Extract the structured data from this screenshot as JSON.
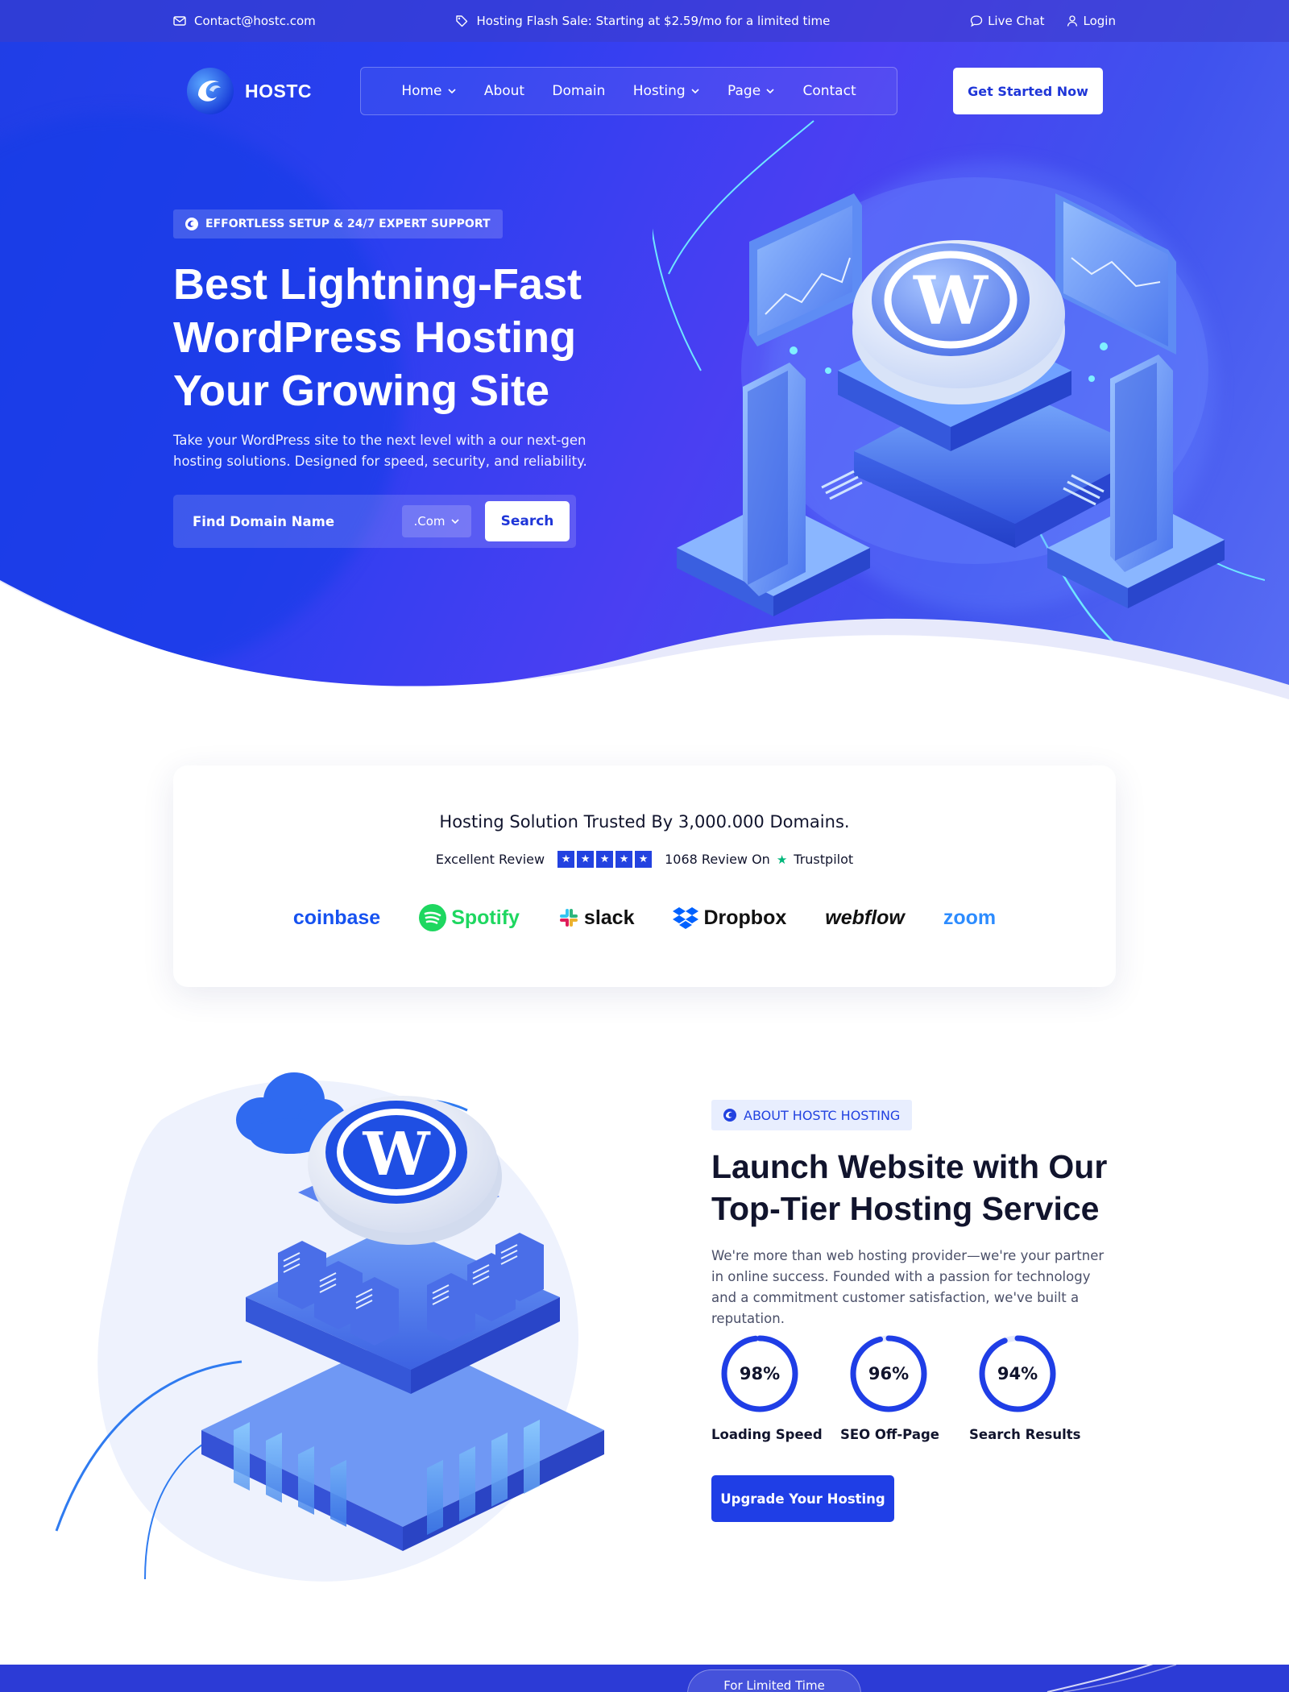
{
  "topbar": {
    "email": "Contact@hostc.com",
    "promo": "Hosting Flash Sale: Starting at $2.59/mo for a limited time",
    "live_chat": "Live Chat",
    "login": "Login"
  },
  "brand": {
    "name": "HOSTC"
  },
  "nav": {
    "items": [
      {
        "label": "Home",
        "dropdown": true
      },
      {
        "label": "About",
        "dropdown": false
      },
      {
        "label": "Domain",
        "dropdown": false
      },
      {
        "label": "Hosting",
        "dropdown": true
      },
      {
        "label": "Page",
        "dropdown": true
      },
      {
        "label": "Contact",
        "dropdown": false
      }
    ],
    "cta": "Get Started Now"
  },
  "hero": {
    "eyebrow": "EFFORTLESS SETUP & 24/7 EXPERT SUPPORT",
    "title_line1": "Best Lightning-Fast",
    "title_line2": "WordPress Hosting",
    "title_line3": "Your Growing Site",
    "description": "Take your WordPress site to the next level with a our next-gen hosting solutions. Designed for speed, security, and reliability.",
    "search": {
      "placeholder": "Find Domain Name",
      "tld_selected": ".Com",
      "button": "Search"
    }
  },
  "trust": {
    "title": "Hosting Solution Trusted By 3,000.000 Domains.",
    "review_label": "Excellent Review",
    "rating_stars": 5,
    "review_count_text": "1068 Review On",
    "review_platform": "Trustpilot",
    "brands": [
      {
        "name": "coinbase",
        "color": "#1652f0"
      },
      {
        "name": "Spotify",
        "color": "#1ed760"
      },
      {
        "name": "slack",
        "color": "#111111"
      },
      {
        "name": "Dropbox",
        "color": "#111111"
      },
      {
        "name": "webflow",
        "color": "#111111"
      },
      {
        "name": "zoom",
        "color": "#2d8cff"
      }
    ]
  },
  "about": {
    "eyebrow": "ABOUT HOSTC HOSTING",
    "title_line1": "Launch Website with Our",
    "title_line2": "Top-Tier Hosting Service",
    "description": "We're more than web hosting provider—we're your partner in online success. Founded with a passion for technology and a commitment customer satisfaction, we've built a reputation.",
    "stats": [
      {
        "value": "98%",
        "percent": 98,
        "label": "Loading Speed"
      },
      {
        "value": "96%",
        "percent": 96,
        "label": "SEO Off-Page"
      },
      {
        "value": "94%",
        "percent": 94,
        "label": "Search Results"
      }
    ],
    "cta": "Upgrade Your Hosting"
  },
  "next_section": {
    "pill": "For Limited Time"
  },
  "colors": {
    "primary": "#1f3ee6",
    "dark_text": "#11142d",
    "white": "#ffffff",
    "accent_light": "#e8eefe"
  },
  "icons": {
    "email": "mail-icon",
    "promo": "tag-icon",
    "chat": "chat-icon",
    "login": "user-icon",
    "rating": "star-icon",
    "trustpilot": "trustpilot-star-icon"
  }
}
